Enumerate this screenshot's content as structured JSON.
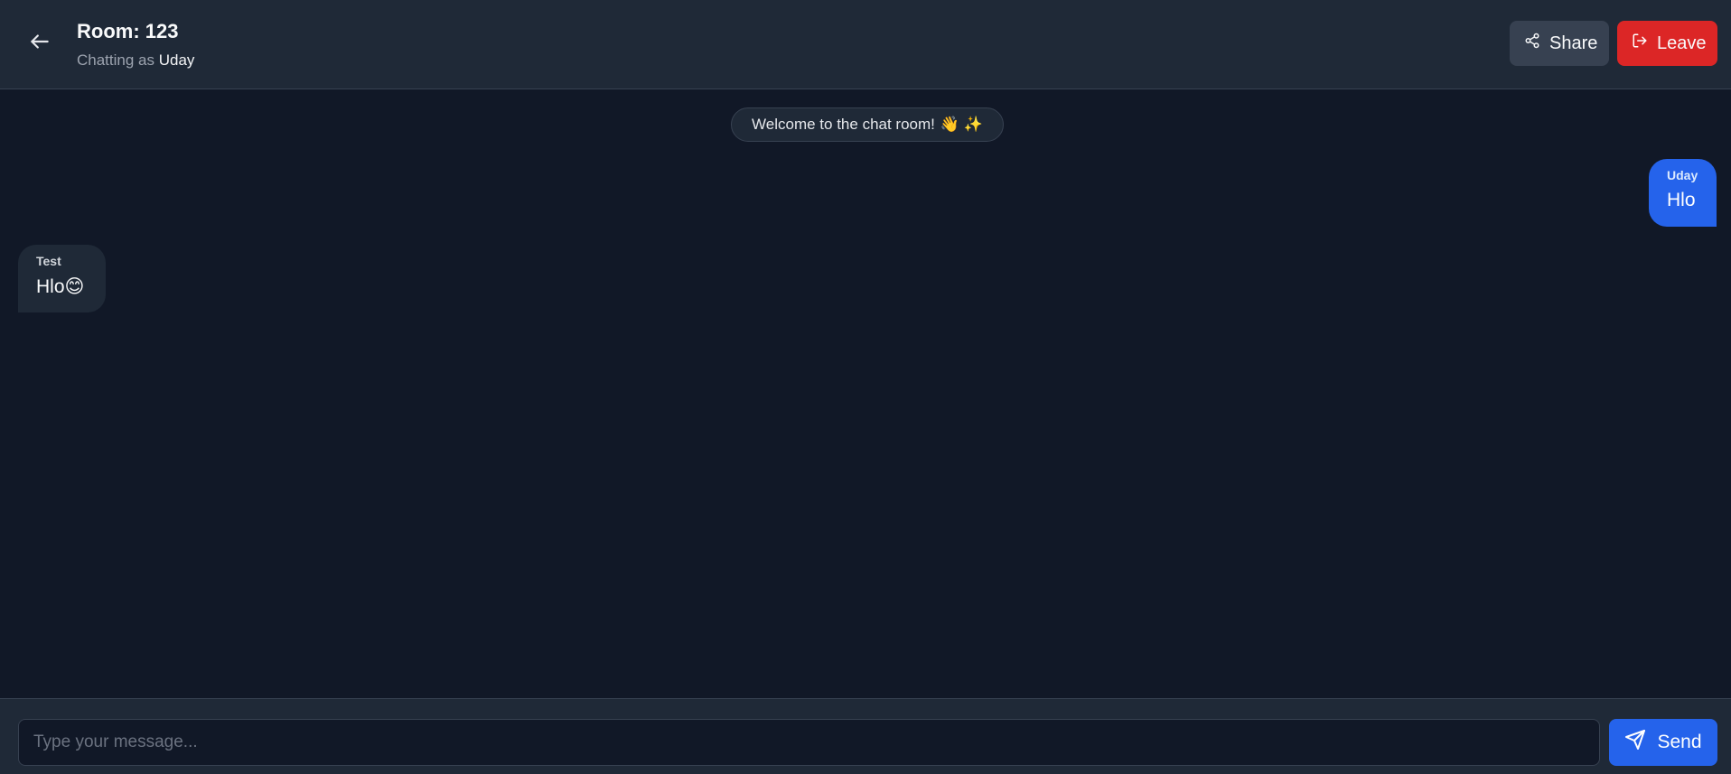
{
  "header": {
    "room_title": "Room: 123",
    "chatting_as_prefix": "Chatting as ",
    "username": "Uday",
    "share_label": "Share",
    "leave_label": "Leave",
    "icons": {
      "back": "arrow-left-icon",
      "share": "share-icon",
      "leave": "log-out-icon"
    }
  },
  "messages": {
    "welcome": "Welcome to the chat room!",
    "welcome_emojis": "👋 ✨",
    "items": [
      {
        "sender": "Uday",
        "text": "Hlo",
        "own": true
      },
      {
        "sender": "Test",
        "text": "Hlo😊",
        "own": false
      }
    ]
  },
  "footer": {
    "input_placeholder": "Type your message...",
    "input_value": "",
    "send_label": "Send",
    "send_icon": "send-icon"
  },
  "colors": {
    "background": "#111827",
    "header_bg": "#1f2937",
    "own_bubble": "#2563eb",
    "other_bubble": "#1f2937",
    "leave": "#dc2626",
    "share": "#374151"
  }
}
